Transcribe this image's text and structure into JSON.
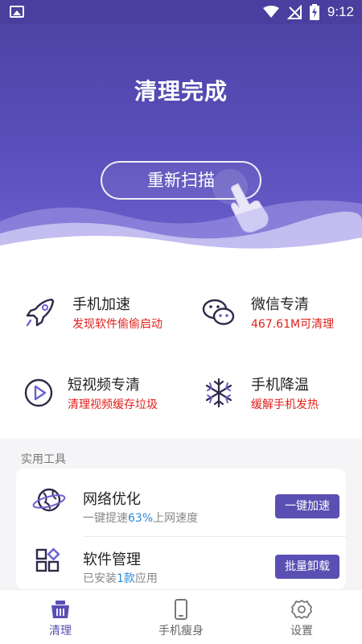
{
  "status_bar": {
    "time": "9:12",
    "icons": [
      "image-icon",
      "wifi-icon",
      "no-signal-icon",
      "battery-charging-icon"
    ]
  },
  "hero": {
    "title": "清理完成",
    "rescan_label": "重新扫描",
    "accent": "#5a4fbb"
  },
  "features": [
    {
      "title": "手机加速",
      "subtitle": "发现软件偷偷启动",
      "icon": "rocket-icon"
    },
    {
      "title": "微信专清",
      "subtitle": "467.61M可清理",
      "icon": "wechat-icon"
    },
    {
      "title": "短视频专清",
      "subtitle": "清理视频缓存垃圾",
      "icon": "play-icon"
    },
    {
      "title": "手机降温",
      "subtitle": "缓解手机发热",
      "icon": "snowflake-icon"
    }
  ],
  "tools": {
    "section_label": "实用工具",
    "items": [
      {
        "title": "网络优化",
        "subtitle_prefix": "一键提速",
        "subtitle_value": "63%",
        "subtitle_suffix": "上网速度",
        "button": "一键加速",
        "icon": "globe-icon"
      },
      {
        "title": "软件管理",
        "subtitle_prefix": "已安装",
        "subtitle_value": "1款",
        "subtitle_suffix": "应用",
        "button": "批量卸载",
        "icon": "apps-icon"
      }
    ]
  },
  "bottom_nav": [
    {
      "label": "清理",
      "icon": "basket-icon",
      "active": true
    },
    {
      "label": "手机瘦身",
      "icon": "phone-icon",
      "active": false
    },
    {
      "label": "设置",
      "icon": "gear-icon",
      "active": false
    }
  ],
  "colors": {
    "primary": "#5a4fb3",
    "warning": "#e0211d",
    "highlight": "#2a8ad9"
  }
}
